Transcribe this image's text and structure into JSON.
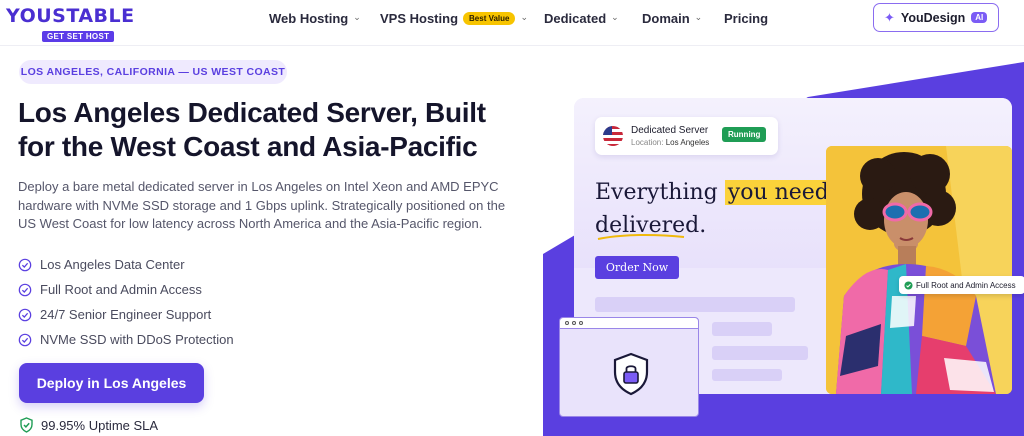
{
  "nav": {
    "logo_main": "YOUSTABLE",
    "logo_sub": "GET SET HOST",
    "items": [
      {
        "label": "Web Hosting"
      },
      {
        "label": "VPS Hosting",
        "badge": "Best Value"
      },
      {
        "label": "Dedicated"
      },
      {
        "label": "Domain"
      },
      {
        "label": "Pricing"
      }
    ],
    "youdesign_label": "YouDesign",
    "youdesign_badge": "AI"
  },
  "hero": {
    "location_pill": "LOS ANGELES, CALIFORNIA — US WEST COAST",
    "title_line1": "Los Angeles Dedicated Server, Built",
    "title_line2": "for the West Coast and Asia-Pacific",
    "description": "Deploy a bare metal dedicated server in Los Angeles on Intel Xeon and AMD EPYC hardware with NVMe SSD storage and 1 Gbps uplink. Strategically positioned on the US West Coast for low latency across North America and the Asia-Pacific region.",
    "features": [
      "Los Angeles Data Center",
      "Full Root and Admin Access",
      "24/7 Senior Engineer Support",
      "NVMe SSD with DDoS Protection"
    ],
    "cta_label": "Deploy in Los Angeles",
    "sla_label": "99.95% Uptime SLA"
  },
  "illustration": {
    "server_title": "Dedicated Server",
    "location_prefix": "Location:",
    "location_value": "Los Angeles",
    "status": "Running",
    "headline_part1": "Everything",
    "headline_highlight": "you need,",
    "headline_part2": "delivered.",
    "order_label": "Order Now",
    "access_tag": "Full Root and Admin Access"
  },
  "colors": {
    "brand": "#5a3fe0",
    "accent_yellow": "#fbd23a",
    "status_green": "#1f9d55"
  }
}
